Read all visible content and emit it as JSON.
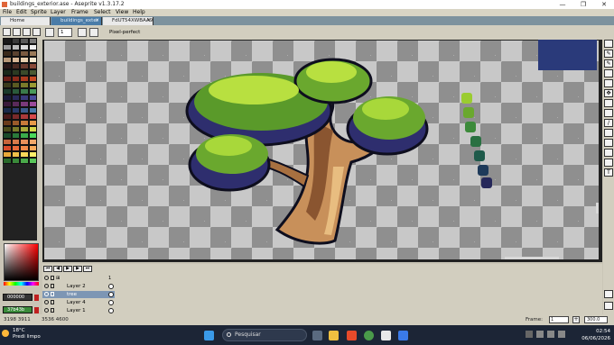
{
  "window": {
    "title": "buildings_exterior.ase - Aseprite v1.3.17.2",
    "minimize": "—",
    "maximize": "❐",
    "close": "✕"
  },
  "menu": [
    "File",
    "Edit",
    "Sprite",
    "Layer",
    "Frame",
    "Select",
    "View",
    "Help"
  ],
  "tabs": [
    {
      "label": "Home",
      "close": ""
    },
    {
      "label": "buildings_exter",
      "close": "✕"
    },
    {
      "label": "FdUT54XWBAA9",
      "close": "✕"
    }
  ],
  "context_bar": {
    "brush_size": "1",
    "pixel_perfect_label": "Pixel-perfect"
  },
  "palette_colors": [
    "#1a1a1a",
    "#3a3a3a",
    "#5a5a5a",
    "#7a7a7a",
    "#9a9a9a",
    "#bababa",
    "#dadada",
    "#f0f0f0",
    "#3a2a1a",
    "#5a4230",
    "#7a5a40",
    "#9a7a58",
    "#b89878",
    "#d8b898",
    "#e8d0b0",
    "#f4e8d0",
    "#2a1818",
    "#4a2a22",
    "#6a3a2e",
    "#8a4a38",
    "#1a2a1a",
    "#2a3a22",
    "#3a4a2a",
    "#4a5a32",
    "#6a2018",
    "#8a2a1a",
    "#aa3a1e",
    "#c84a22",
    "#3a3a1a",
    "#5a5a22",
    "#7a7a2a",
    "#9a9a32",
    "#1a3a2a",
    "#2a5a3a",
    "#3a7a4a",
    "#4a9a5a",
    "#1a1a3a",
    "#2a2a5a",
    "#3a3a7a",
    "#4a4a9a",
    "#3a1a3a",
    "#5a2a5a",
    "#7a3a7a",
    "#9a4a9a",
    "#1a2a4a",
    "#2a3a6a",
    "#3a5a8a",
    "#4a7aaa",
    "#4a1a1a",
    "#7a2a2a",
    "#aa3a3a",
    "#d84a4a",
    "#6a3a1a",
    "#9a5a2a",
    "#c87a3a",
    "#e89a4a",
    "#4a4a1a",
    "#7a7a2a",
    "#aaaa3a",
    "#d8d84a",
    "#1a4a2a",
    "#2a7a3a",
    "#3aaa4a",
    "#4ad85a",
    "#c8643a",
    "#d87a4a",
    "#e8905a",
    "#f0a86a",
    "#d84a2a",
    "#e86a3a",
    "#f08a4a",
    "#f8aa5a",
    "#e8a83a",
    "#f0c04a",
    "#f8d85a",
    "#fff06a",
    "#2a6a2a",
    "#3a8a3a",
    "#4aaa4a",
    "#5ac85a"
  ],
  "fg_color_label": "000000",
  "bg_color_label": "37b43b",
  "timeline": {
    "buttons": [
      "⏮",
      "◀",
      "▶",
      "▶",
      "⏭"
    ],
    "layers": [
      {
        "name": "",
        "icon": "⊞",
        "selected": false
      },
      {
        "name": "Layer 2",
        "selected": false
      },
      {
        "name": "tree",
        "selected": true
      },
      {
        "name": "Layer 4",
        "selected": false
      },
      {
        "name": "Layer 1",
        "selected": false
      }
    ],
    "frame_number": "1"
  },
  "status": {
    "cursor": "3198 3911",
    "size": "3536 4600",
    "frame_label": "Frame:",
    "frame_value": "1",
    "zoom": "300.0"
  },
  "taskbar": {
    "weather_temp": "18°C",
    "weather_text": "Predi limpo",
    "search_placeholder": "Pesquisar",
    "time": "02:54",
    "date": "06/06/2026"
  },
  "colors": {
    "foliage_dark": "#2e2e6e",
    "foliage_mid": "#5a9a2a",
    "foliage_light": "#b8e040",
    "trunk_dark": "#7a4a2a",
    "trunk_light": "#d8a868",
    "outline": "#0e0e1e"
  }
}
